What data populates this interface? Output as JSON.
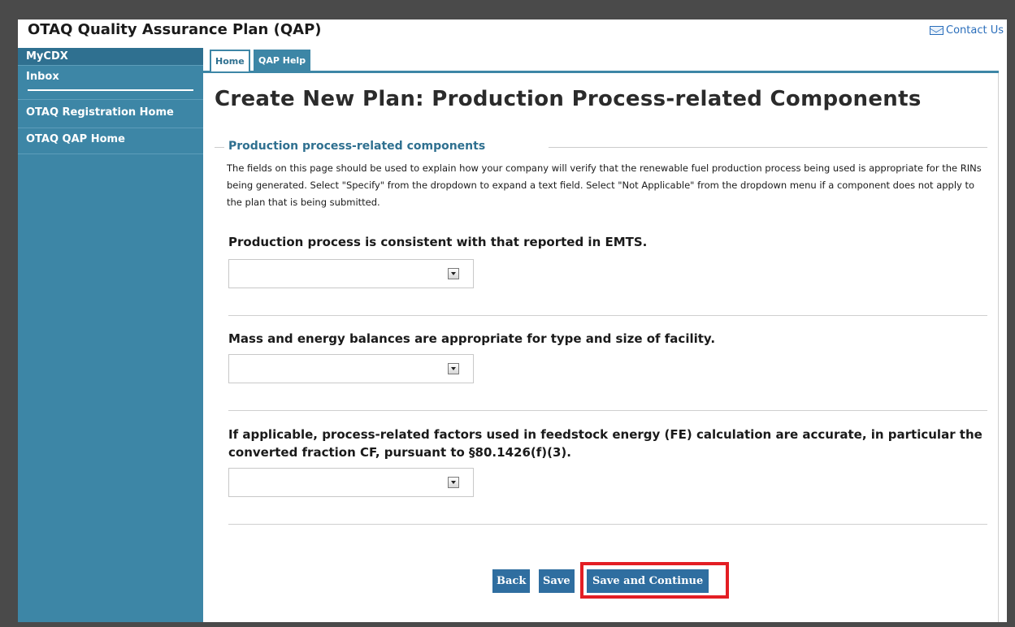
{
  "header": {
    "app_title": "OTAQ Quality Assurance Plan (QAP)",
    "contact_label": "Contact Us"
  },
  "sidebar": {
    "items": [
      {
        "label": "MyCDX"
      },
      {
        "label": "Inbox"
      },
      {
        "label": "OTAQ Registration Home"
      },
      {
        "label": "OTAQ QAP Home"
      }
    ]
  },
  "tabs": [
    {
      "label": "Home",
      "active": true
    },
    {
      "label": "QAP Help",
      "active": false
    }
  ],
  "main": {
    "page_title": "Create New Plan: Production Process-related Components",
    "section_legend": "Production process-related components",
    "intro_text": "The fields on this page should be used to explain how your company will verify that the renewable fuel production process being used is appropriate for the RINs being generated. Select \"Specify\" from the dropdown to expand a text field. Select \"Not Applicable\" from the dropdown menu if a component does not apply to the plan that is being submitted.",
    "questions": [
      {
        "label": "Production process is consistent with that reported in EMTS.",
        "selected": ""
      },
      {
        "label": "Mass and energy balances are appropriate for type and size of facility.",
        "selected": ""
      },
      {
        "label": "If applicable, process-related factors used in feedstock energy (FE) calculation are accurate, in particular the converted fraction CF, pursuant to §80.1426(f)(3).",
        "selected": ""
      }
    ]
  },
  "buttons": {
    "back": "Back",
    "save": "Save",
    "save_continue": "Save and Continue"
  },
  "colors": {
    "sidebar": "#3d86a6",
    "accent": "#2f7090",
    "button": "#2f6ea0",
    "highlight": "#e31e24"
  },
  "icons": {
    "contact": "mail-icon",
    "select": "chevron-down-icon"
  }
}
